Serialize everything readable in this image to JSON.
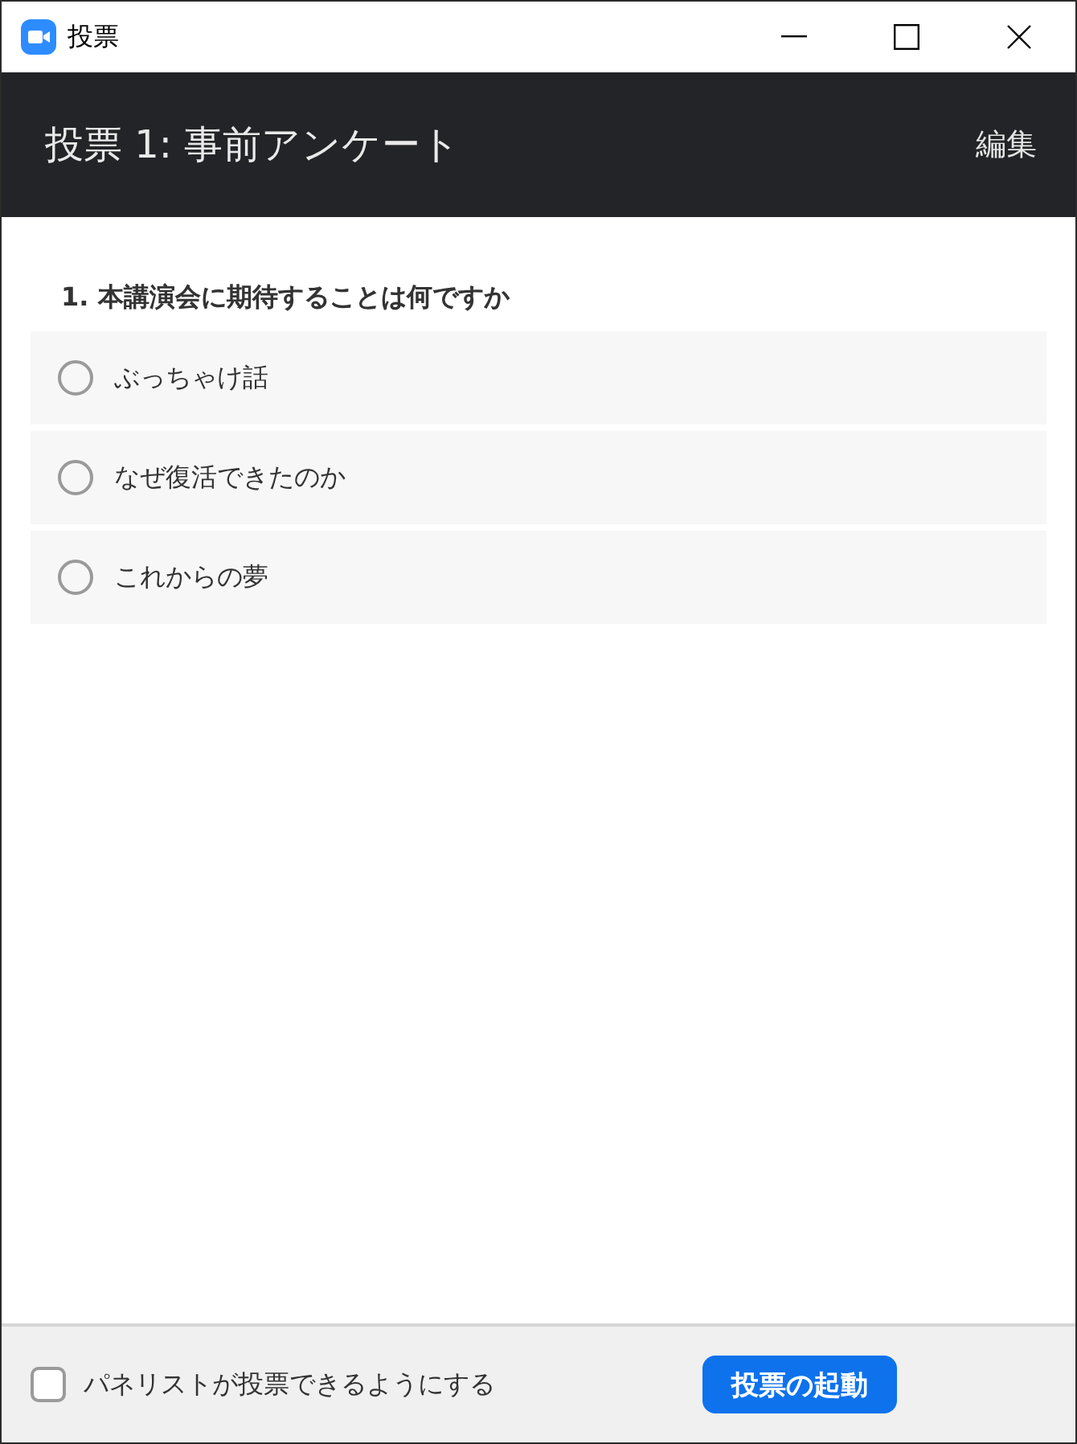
{
  "window": {
    "title": "投票"
  },
  "header": {
    "title": "投票 1: 事前アンケート",
    "edit_link": "編集"
  },
  "question": {
    "text": "1. 本講演会に期待することは何ですか",
    "options": [
      {
        "label": "ぶっちゃけ話",
        "selected": false
      },
      {
        "label": "なぜ復活できたのか",
        "selected": false
      },
      {
        "label": "これからの夢",
        "selected": false
      }
    ]
  },
  "footer": {
    "checkbox": {
      "label": "パネリストが投票できるようにする",
      "checked": false
    },
    "button": "投票の起動"
  }
}
